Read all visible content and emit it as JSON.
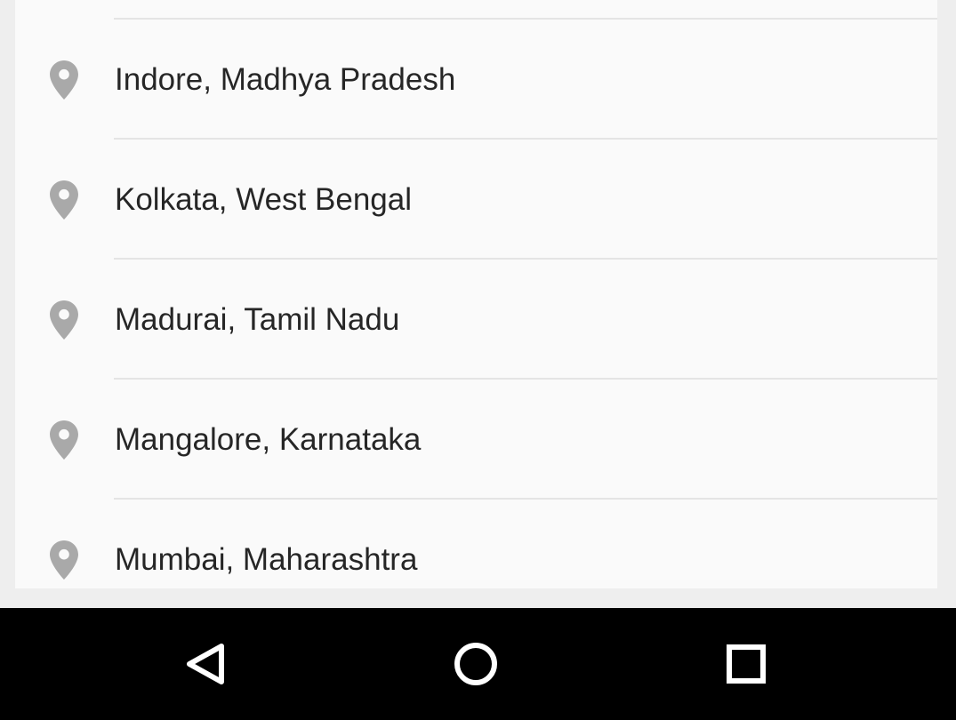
{
  "locations": [
    {
      "label": "Indore, Madhya Pradesh",
      "icon": "location-pin-icon"
    },
    {
      "label": "Kolkata, West Bengal",
      "icon": "location-pin-icon"
    },
    {
      "label": "Madurai, Tamil Nadu",
      "icon": "location-pin-icon"
    },
    {
      "label": "Mangalore, Karnataka",
      "icon": "location-pin-icon"
    },
    {
      "label": "Mumbai, Maharashtra",
      "icon": "location-pin-icon"
    }
  ],
  "navigation_bar": {
    "buttons": [
      {
        "icon": "back-triangle-icon"
      },
      {
        "icon": "home-circle-icon"
      },
      {
        "icon": "recents-square-icon"
      }
    ]
  },
  "colors": {
    "screen_background": "#eeeeee",
    "list_background": "#fafafa",
    "divider": "#e4e4e4",
    "text": "#262626",
    "pin_icon": "#a9a9a9",
    "nav_bar": "#000000",
    "nav_icon": "#ffffff"
  }
}
